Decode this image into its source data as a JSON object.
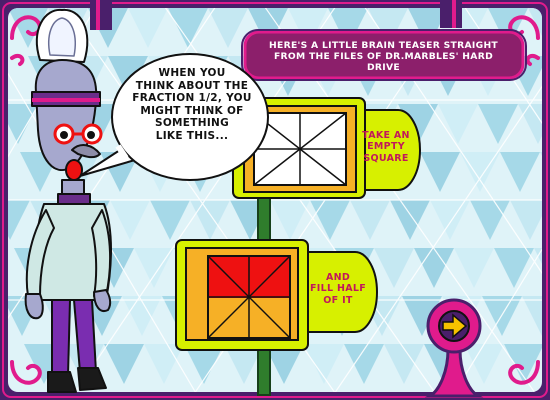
{
  "speech_bubble": {
    "lines": [
      "WHEN YOU",
      "THINK ABOUT THE",
      "FRACTION 1/2, YOU",
      "MIGHT THINK OF",
      "SOMETHING",
      "LIKE THIS..."
    ]
  },
  "banner": {
    "line1": "HERE'S A LITTLE BRAIN TEASER STRAIGHT",
    "line2": "FROM THE FILES OF DR.MARBLES' HARD DRIVE"
  },
  "step1": {
    "lines": [
      "TAKE AN",
      "EMPTY",
      "SQUARE"
    ]
  },
  "step2": {
    "lines": [
      "AND",
      "FILL HALF",
      "OF IT"
    ]
  },
  "puzzle": {
    "total_parts": 8,
    "filled_parts": 4,
    "fraction_filled": 0.5
  },
  "next_button": {
    "icon": "arrow-right-icon"
  },
  "colors": {
    "frame_purple": "#4a1f6b",
    "frame_pink": "#e01b8c",
    "teal_tiles": "#a6d9e8",
    "light_tiles": "#e3f4f9",
    "banner_purple": "#8c1f6b",
    "card_yellow": "#d7f000",
    "card_orange": "#f6b026",
    "fill_red": "#ee1111",
    "pole_green": "#2f7d2c",
    "label_text_pink": "#c2185b"
  }
}
